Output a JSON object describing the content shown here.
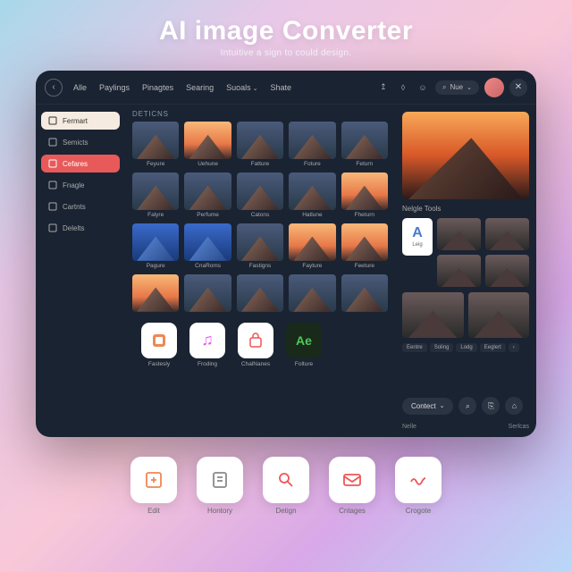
{
  "hero": {
    "title": "AI image Converter",
    "subtitle": "Intuitive a sign to could design."
  },
  "topnav": {
    "items": [
      {
        "label": "Alle"
      },
      {
        "label": "Paylings"
      },
      {
        "label": "Pinagtes"
      },
      {
        "label": "Searing"
      },
      {
        "label": "Suoals",
        "drop": true
      },
      {
        "label": "Shate"
      }
    ],
    "search": "Nue"
  },
  "sidebar": {
    "items": [
      {
        "label": "Fermart",
        "variant": "light"
      },
      {
        "label": "Semicts"
      },
      {
        "label": "Cefares",
        "variant": "red"
      },
      {
        "label": "Fnagle"
      },
      {
        "label": "Cartnts"
      },
      {
        "label": "Delelts"
      }
    ]
  },
  "gallery": {
    "section": "DETICNS",
    "rows": [
      [
        "Feyure",
        "Uehune",
        "Fatture",
        "Foture",
        "Feturn"
      ],
      [
        "Falyre",
        "Perfume",
        "Catons",
        "Hatlune",
        "Fheturn"
      ],
      [
        "Pagure",
        "CnaRoms",
        "Fastigns",
        "Fayture",
        "Feeture"
      ],
      [
        "",
        "",
        "",
        "",
        ""
      ]
    ]
  },
  "apps": [
    {
      "label": "Fastesly",
      "glyph": "app1"
    },
    {
      "label": "Froding",
      "glyph": "music"
    },
    {
      "label": "ChalNanes",
      "glyph": "bag"
    },
    {
      "label": "Folture",
      "glyph": "ae"
    }
  ],
  "right": {
    "tools_label": "Nelgle Tools",
    "tool": {
      "letter": "A",
      "label": "Leig"
    },
    "chips": [
      "Eentre",
      "Soling",
      "Lodg",
      "Eeglert"
    ],
    "contact": "Contect",
    "foot_left": "Nelle",
    "foot_right": "Serlcas"
  },
  "dock": [
    {
      "label": "Edit",
      "icon": "edit"
    },
    {
      "label": "Hontory",
      "icon": "history"
    },
    {
      "label": "Detign",
      "icon": "design"
    },
    {
      "label": "Cntages",
      "icon": "mail"
    },
    {
      "label": "Crogote",
      "icon": "wave"
    }
  ]
}
